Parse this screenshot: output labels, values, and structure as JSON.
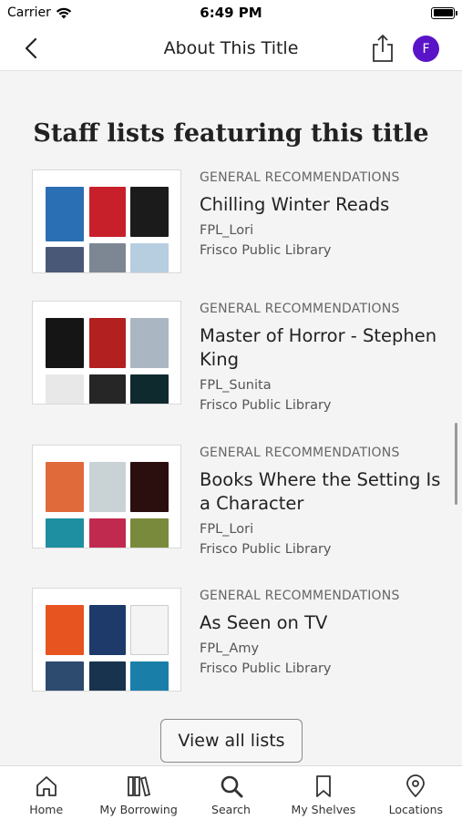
{
  "status_bar": {
    "carrier": "Carrier",
    "time": "6:49 PM"
  },
  "header": {
    "title": "About This Title",
    "avatar_initial": "F"
  },
  "section": {
    "title": "Staff lists featuring this title",
    "lists": [
      {
        "category": "GENERAL RECOMMENDATIONS",
        "title": "Chilling Winter Reads",
        "author": "FPL_Lori",
        "library": "Frisco Public Library",
        "cover_colors": [
          "#2a6fb3",
          "#c8202a",
          "#1b1b1b",
          "#4a5878",
          "#7d8794",
          "#b7cde0"
        ]
      },
      {
        "category": "GENERAL RECOMMENDATIONS",
        "title": "Master of Horror - Stephen King",
        "author": "FPL_Sunita",
        "library": "Frisco Public Library",
        "cover_colors": [
          "#151515",
          "#b32020",
          "#aab7c2",
          "#e8e8e8",
          "#262626",
          "#0f2a2e"
        ]
      },
      {
        "category": "GENERAL RECOMMENDATIONS",
        "title": "Books Where the Setting Is a Character",
        "author": "FPL_Lori",
        "library": "Frisco Public Library",
        "cover_colors": [
          "#e06a3a",
          "#c9d3d6",
          "#2b0e0e",
          "#1e8fa0",
          "#c02a4f",
          "#7a8a3c"
        ]
      },
      {
        "category": "GENERAL RECOMMENDATIONS",
        "title": "As Seen on TV",
        "author": "FPL_Amy",
        "library": "Frisco Public Library",
        "cover_colors": [
          "#e8541f",
          "#1d3a6b",
          "#f4f4f4",
          "#2d4a6f",
          "#17334e",
          "#1a7fa8"
        ]
      }
    ],
    "view_all_label": "View all lists"
  },
  "tabs": [
    {
      "label": "Home",
      "icon": "home-icon"
    },
    {
      "label": "My Borrowing",
      "icon": "books-icon"
    },
    {
      "label": "Search",
      "icon": "search-icon"
    },
    {
      "label": "My Shelves",
      "icon": "bookmark-icon"
    },
    {
      "label": "Locations",
      "icon": "location-pin-icon"
    }
  ],
  "colors": {
    "accent": "#5a14c8",
    "background": "#f4f4f4"
  }
}
